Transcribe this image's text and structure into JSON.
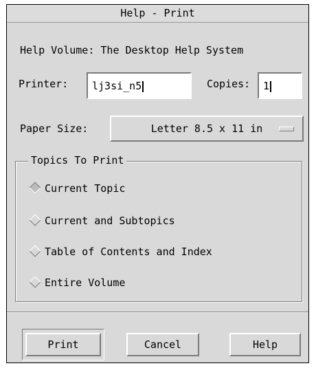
{
  "window": {
    "title": "Help - Print"
  },
  "help_volume": {
    "text": "Help Volume: The Desktop Help System"
  },
  "printer": {
    "label": "Printer:",
    "value": "lj3si_n5"
  },
  "copies": {
    "label": "Copies:",
    "value": "1"
  },
  "paper_size": {
    "label": "Paper Size:",
    "value": "Letter 8.5 x 11 in"
  },
  "topics": {
    "title": "Topics To Print",
    "options": [
      {
        "label": "Current Topic",
        "selected": true
      },
      {
        "label": "Current and Subtopics",
        "selected": false
      },
      {
        "label": "Table of Contents and Index",
        "selected": false
      },
      {
        "label": "Entire Volume",
        "selected": false
      }
    ]
  },
  "buttons": {
    "print": "Print",
    "cancel": "Cancel",
    "help": "Help"
  }
}
